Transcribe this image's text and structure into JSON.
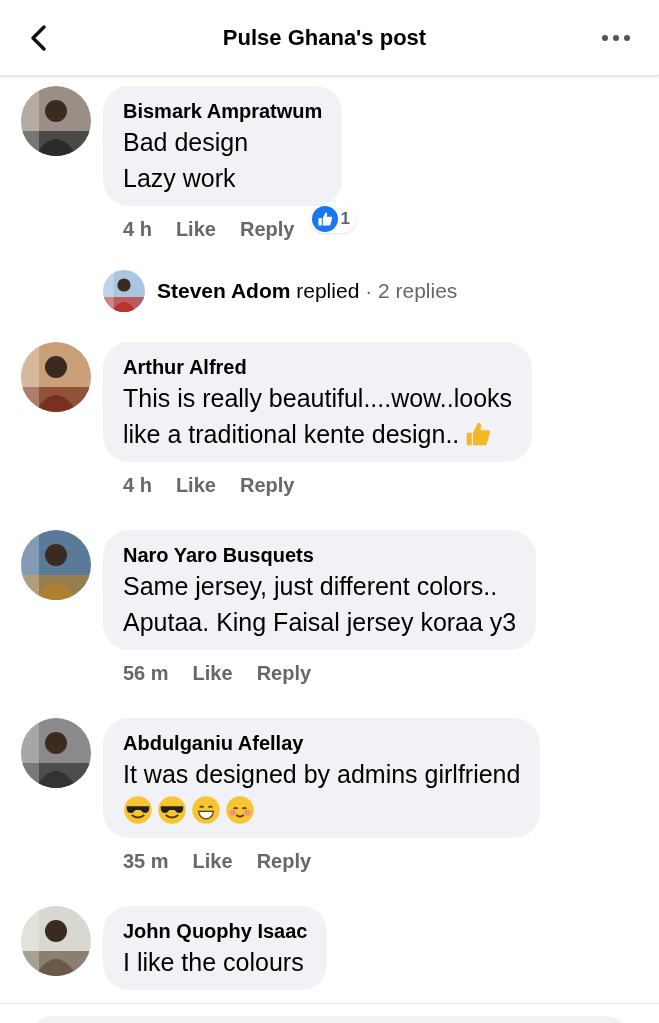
{
  "header": {
    "title": "Pulse Ghana's post"
  },
  "comments": [
    {
      "author": "Bismark Ampratwum",
      "lines": [
        {
          "text": "Bad design"
        },
        {
          "text": "Lazy work"
        }
      ],
      "time": "4 h",
      "like": "Like",
      "reply": "Reply",
      "reactions": {
        "count": "1"
      },
      "replies_summary": {
        "author": "Steven Adom",
        "verb": "replied",
        "count": "· 2 replies"
      }
    },
    {
      "author": "Arthur Alfred",
      "lines": [
        {
          "text": "This is really beautiful....wow..looks"
        },
        {
          "text": "like a traditional kente design..",
          "emoji": [
            {
              "kind": "thumbs-up"
            }
          ]
        }
      ],
      "time": "4 h",
      "like": "Like",
      "reply": "Reply"
    },
    {
      "author": "Naro Yaro Busquets",
      "lines": [
        {
          "text": "Same jersey,  just different colors.."
        },
        {
          "text": "Aputaa.  King Faisal jersey koraa y3"
        }
      ],
      "time": "56 m",
      "like": "Like",
      "reply": "Reply"
    },
    {
      "author": "Abdulganiu Afellay",
      "lines": [
        {
          "text": "It was designed by admins girlfriend"
        },
        {
          "emoji": [
            {
              "kind": "sunglasses"
            },
            {
              "kind": "sunglasses"
            },
            {
              "kind": "grin"
            },
            {
              "kind": "smiling"
            }
          ]
        }
      ],
      "time": "35 m",
      "like": "Like",
      "reply": "Reply"
    },
    {
      "author": "John Quophy Isaac",
      "lines": [
        {
          "text": "I like the colours"
        }
      ]
    }
  ]
}
